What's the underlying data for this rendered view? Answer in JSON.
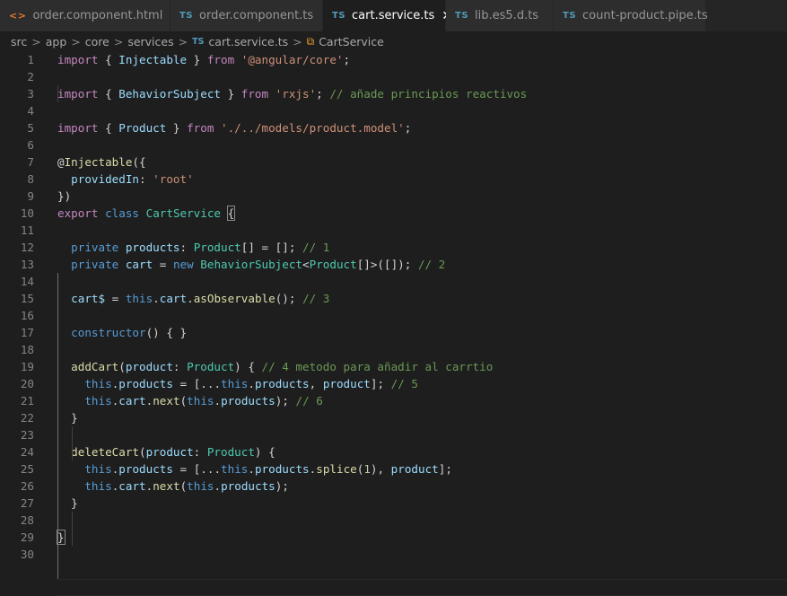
{
  "tabs": [
    {
      "icon": "html-file-icon",
      "badge": "<>",
      "label": "order.component.html",
      "modified": true,
      "active": false
    },
    {
      "icon": "ts-file-icon",
      "badge": "TS",
      "label": "order.component.ts",
      "modified": false,
      "active": false
    },
    {
      "icon": "ts-file-icon",
      "badge": "TS",
      "label": "cart.service.ts",
      "modified": false,
      "active": true
    },
    {
      "icon": "ts-file-icon",
      "badge": "TS",
      "label": "lib.es5.d.ts",
      "modified": true,
      "active": false
    },
    {
      "icon": "ts-file-icon",
      "badge": "TS",
      "label": "count-product.pipe.ts",
      "modified": false,
      "active": false
    }
  ],
  "breadcrumb": {
    "parts": [
      "src",
      "app",
      "core",
      "services"
    ],
    "file_badge": "TS",
    "file": "cart.service.ts",
    "symbol": "CartService",
    "separator": ">"
  },
  "line_numbers": [
    "1",
    "2",
    "3",
    "4",
    "5",
    "6",
    "7",
    "8",
    "9",
    "10",
    "11",
    "12",
    "13",
    "14",
    "15",
    "16",
    "17",
    "18",
    "19",
    "20",
    "21",
    "22",
    "23",
    "24",
    "25",
    "26",
    "27",
    "28",
    "29",
    "30"
  ],
  "code": {
    "l1": [
      "import",
      " { ",
      "Injectable",
      " } ",
      "from",
      " ",
      "'@angular/core'",
      ";"
    ],
    "l3": [
      "import",
      " { ",
      "BehaviorSubject",
      " } ",
      "from",
      " ",
      "'rxjs'",
      "; ",
      "// añade principios reactivos"
    ],
    "l5": [
      "import",
      " { ",
      "Product",
      " } ",
      "from",
      " ",
      "'./../models/product.model'",
      ";"
    ],
    "l7": [
      "@",
      "Injectable",
      "({"
    ],
    "l8": [
      "  ",
      "providedIn",
      ": ",
      "'root'"
    ],
    "l9": [
      "})"
    ],
    "l10": [
      "export",
      " ",
      "class",
      " ",
      "CartService",
      " ",
      "{"
    ],
    "l12": [
      "  ",
      "private",
      " ",
      "products",
      ": ",
      "Product",
      "[] = []; ",
      "// 1"
    ],
    "l13": [
      "  ",
      "private",
      " ",
      "cart",
      " = ",
      "new",
      " ",
      "BehaviorSubject",
      "<",
      "Product",
      "[]>([]); ",
      "// 2"
    ],
    "l15": [
      "  ",
      "cart$",
      " = ",
      "this",
      ".",
      "cart",
      ".",
      "asObservable",
      "(); ",
      "// 3"
    ],
    "l17": [
      "  ",
      "constructor",
      "() { }"
    ],
    "l19": [
      "  ",
      "addCart",
      "(",
      "product",
      ": ",
      "Product",
      ") { ",
      "// 4 metodo para añadir al carrtio"
    ],
    "l20": [
      "    ",
      "this",
      ".",
      "products",
      " = [...",
      "this",
      ".",
      "products",
      ", ",
      "product",
      "]; ",
      "// 5"
    ],
    "l21": [
      "    ",
      "this",
      ".",
      "cart",
      ".",
      "next",
      "(",
      "this",
      ".",
      "products",
      "); ",
      "// 6"
    ],
    "l22": [
      "  ",
      "}"
    ],
    "l24": [
      "  ",
      "deleteCart",
      "(",
      "product",
      ": ",
      "Product",
      ") {"
    ],
    "l25": [
      "    ",
      "this",
      ".",
      "products",
      " = [...",
      "this",
      ".",
      "products",
      ".",
      "splice",
      "(",
      "1",
      "), ",
      "product",
      "];"
    ],
    "l26": [
      "    ",
      "this",
      ".",
      "cart",
      ".",
      "next",
      "(",
      "this",
      ".",
      "products",
      ");"
    ],
    "l27": [
      "  ",
      "}"
    ],
    "l29": [
      "}"
    ]
  }
}
